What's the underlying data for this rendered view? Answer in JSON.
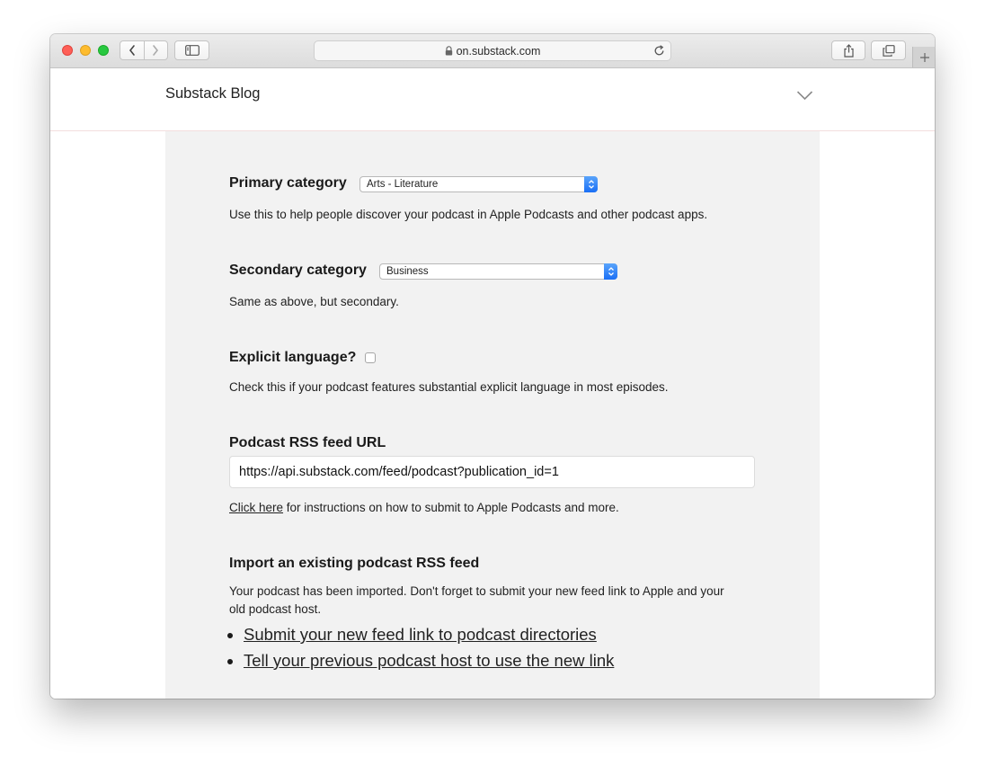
{
  "browser": {
    "url": "on.substack.com"
  },
  "site": {
    "title": "Substack Blog"
  },
  "settings": {
    "primary_category": {
      "label": "Primary category",
      "value": "Arts - Literature",
      "help": "Use this to help people discover your podcast in Apple Podcasts and other podcast apps."
    },
    "secondary_category": {
      "label": "Secondary category",
      "value": "Business",
      "help": "Same as above, but secondary."
    },
    "explicit": {
      "label": "Explicit language?",
      "checked": false,
      "help": "Check this if your podcast features substantial explicit language in most episodes."
    },
    "rss": {
      "label": "Podcast RSS feed URL",
      "value": "https://api.substack.com/feed/podcast?publication_id=1",
      "help_link": "Click here",
      "help_rest": " for instructions on how to submit to Apple Podcasts and more."
    },
    "import": {
      "label": "Import an existing podcast RSS feed",
      "message_line1": "Your podcast has been imported. Don't forget to submit your new feed link to Apple and your",
      "message_line2": "old podcast host.",
      "links": [
        "Submit your new feed link to podcast directories",
        "Tell your previous podcast host to use the new link"
      ]
    }
  },
  "colors": {
    "panel_bg": "#f2f2f2",
    "select_accent": "#1a6ff5"
  }
}
